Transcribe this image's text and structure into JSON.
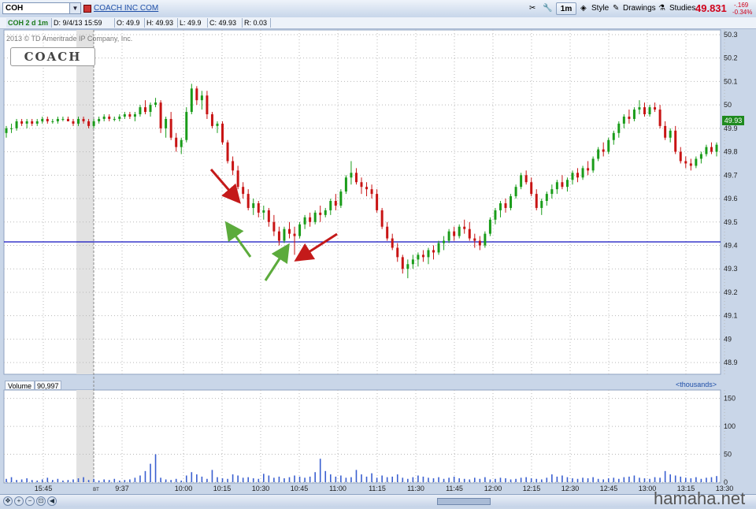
{
  "toolbar": {
    "symbol": "COH",
    "company_name": "COACH INC COM",
    "timeframe_label": "1m",
    "style_label": "Style",
    "drawings_label": "Drawings",
    "studies_label": "Studies",
    "last_price": "49.831",
    "change": "-.169",
    "change_pct": "-0.34%"
  },
  "info_bar": {
    "chart_label": "COH 2 d 1m",
    "date": "D: 9/4/13 15:59",
    "open": "O: 49.9",
    "high": "H: 49.93",
    "low": "L: 49.9",
    "close": "C: 49.93",
    "range": "R: 0.03"
  },
  "overlay": {
    "copyright": "2013 © TD Ameritrade IP Company, Inc.",
    "logo_text": "COACH",
    "price_badge": "49.93"
  },
  "volume": {
    "label": "Volume",
    "value": "90,997",
    "units": "<thousands>"
  },
  "watermark": "hamaha.net",
  "colors": {
    "up": "#1a9c1a",
    "down": "#c81414",
    "hline": "#1010c0",
    "volume": "#3a5fd0"
  },
  "chart_data": {
    "type": "candlestick",
    "price_axis": {
      "ylim": [
        48.85,
        50.32
      ],
      "ticks": [
        50.3,
        50.2,
        50.1,
        50,
        49.9,
        49.8,
        49.7,
        49.6,
        49.5,
        49.4,
        49.3,
        49.2,
        49.1,
        49,
        48.9
      ],
      "tick_labels": [
        "50.3",
        "50.2",
        "50.1",
        "50",
        "49.9",
        "49.8",
        "49.7",
        "49.6",
        "49.5",
        "49.4",
        "49.3",
        "49.2",
        "49.1",
        "49",
        "48.9"
      ]
    },
    "volume_axis": {
      "ylim": [
        0,
        165
      ],
      "ticks": [
        150,
        100,
        50,
        0
      ],
      "tick_labels": [
        "150",
        "100",
        "50",
        "0"
      ]
    },
    "time_axis": {
      "labels": [
        "15:45",
        "BT",
        "9:37",
        "10:00",
        "10:15",
        "10:30",
        "10:45",
        "11:00",
        "11:15",
        "11:30",
        "11:45",
        "12:00",
        "12:15",
        "12:30",
        "12:45",
        "13:00",
        "13:15",
        "13:30"
      ]
    },
    "horizontal_line": 49.415,
    "bars": [
      [
        49.88,
        49.91,
        49.86,
        49.9
      ],
      [
        49.9,
        49.92,
        49.88,
        49.9
      ],
      [
        49.9,
        49.94,
        49.89,
        49.93
      ],
      [
        49.93,
        49.94,
        49.91,
        49.92
      ],
      [
        49.92,
        49.94,
        49.9,
        49.93
      ],
      [
        49.93,
        49.94,
        49.91,
        49.92
      ],
      [
        49.92,
        49.94,
        49.91,
        49.93
      ],
      [
        49.93,
        49.95,
        49.92,
        49.94
      ],
      [
        49.94,
        49.95,
        49.92,
        49.93
      ],
      [
        49.93,
        49.94,
        49.92,
        49.93
      ],
      [
        49.93,
        49.95,
        49.92,
        49.94
      ],
      [
        49.94,
        49.95,
        49.93,
        49.94
      ],
      [
        49.94,
        49.95,
        49.93,
        49.93
      ],
      [
        49.93,
        49.94,
        49.91,
        49.92
      ],
      [
        49.92,
        49.95,
        49.91,
        49.94
      ],
      [
        49.94,
        49.95,
        49.92,
        49.93
      ],
      [
        49.93,
        49.94,
        49.9,
        49.91
      ],
      [
        49.91,
        49.94,
        49.9,
        49.93
      ],
      [
        49.93,
        49.95,
        49.92,
        49.94
      ],
      [
        49.94,
        49.96,
        49.93,
        49.95
      ],
      [
        49.95,
        49.96,
        49.93,
        49.94
      ],
      [
        49.94,
        49.95,
        49.93,
        49.94
      ],
      [
        49.94,
        49.96,
        49.93,
        49.95
      ],
      [
        49.95,
        49.97,
        49.94,
        49.96
      ],
      [
        49.96,
        49.97,
        49.94,
        49.95
      ],
      [
        49.95,
        49.97,
        49.93,
        49.96
      ],
      [
        49.96,
        50.0,
        49.95,
        49.99
      ],
      [
        49.99,
        50.02,
        49.96,
        49.97
      ],
      [
        49.97,
        50.01,
        49.95,
        50.0
      ],
      [
        50.0,
        50.03,
        49.99,
        50.01
      ],
      [
        50.01,
        50.02,
        49.88,
        49.9
      ],
      [
        49.9,
        49.95,
        49.86,
        49.94
      ],
      [
        49.94,
        49.97,
        49.85,
        49.86
      ],
      [
        49.86,
        49.88,
        49.8,
        49.82
      ],
      [
        49.82,
        49.86,
        49.79,
        49.85
      ],
      [
        49.85,
        49.99,
        49.84,
        49.97
      ],
      [
        49.97,
        50.09,
        49.96,
        50.07
      ],
      [
        50.07,
        50.08,
        50.0,
        50.02
      ],
      [
        50.02,
        50.06,
        49.98,
        50.04
      ],
      [
        50.04,
        50.06,
        49.94,
        49.96
      ],
      [
        49.96,
        49.97,
        49.9,
        49.91
      ],
      [
        49.91,
        49.93,
        49.88,
        49.92
      ],
      [
        49.92,
        49.93,
        49.83,
        49.84
      ],
      [
        49.84,
        49.85,
        49.75,
        49.76
      ],
      [
        49.76,
        49.78,
        49.7,
        49.72
      ],
      [
        49.72,
        49.74,
        49.64,
        49.65
      ],
      [
        49.65,
        49.67,
        49.6,
        49.62
      ],
      [
        49.62,
        49.64,
        49.55,
        49.56
      ],
      [
        49.56,
        49.6,
        49.53,
        49.58
      ],
      [
        49.58,
        49.59,
        49.52,
        49.54
      ],
      [
        49.54,
        49.57,
        49.51,
        49.55
      ],
      [
        49.55,
        49.56,
        49.48,
        49.5
      ],
      [
        49.5,
        49.53,
        49.44,
        49.46
      ],
      [
        49.46,
        49.48,
        49.4,
        49.42
      ],
      [
        49.42,
        49.48,
        49.41,
        49.47
      ],
      [
        49.47,
        49.5,
        49.43,
        49.45
      ],
      [
        49.45,
        49.48,
        49.36,
        49.44
      ],
      [
        49.44,
        49.5,
        49.43,
        49.49
      ],
      [
        49.49,
        49.53,
        49.47,
        49.52
      ],
      [
        49.52,
        49.54,
        49.48,
        49.5
      ],
      [
        49.5,
        49.55,
        49.49,
        49.54
      ],
      [
        49.54,
        49.57,
        49.5,
        49.53
      ],
      [
        49.53,
        49.56,
        49.52,
        49.55
      ],
      [
        49.55,
        49.6,
        49.53,
        49.59
      ],
      [
        49.59,
        49.62,
        49.55,
        49.57
      ],
      [
        49.57,
        49.64,
        49.56,
        49.63
      ],
      [
        49.63,
        49.7,
        49.62,
        49.69
      ],
      [
        49.69,
        49.76,
        49.66,
        49.71
      ],
      [
        49.71,
        49.73,
        49.66,
        49.67
      ],
      [
        49.67,
        49.69,
        49.62,
        49.65
      ],
      [
        49.65,
        49.67,
        49.61,
        49.64
      ],
      [
        49.64,
        49.66,
        49.6,
        49.62
      ],
      [
        49.62,
        49.64,
        49.54,
        49.55
      ],
      [
        49.55,
        49.56,
        49.47,
        49.48
      ],
      [
        49.48,
        49.5,
        49.42,
        49.43
      ],
      [
        49.43,
        49.45,
        49.38,
        49.39
      ],
      [
        49.39,
        49.41,
        49.33,
        49.35
      ],
      [
        49.35,
        49.36,
        49.28,
        49.3
      ],
      [
        49.3,
        49.34,
        49.26,
        49.32
      ],
      [
        49.32,
        49.36,
        49.3,
        49.34
      ],
      [
        49.34,
        49.37,
        49.31,
        49.36
      ],
      [
        49.36,
        49.38,
        49.33,
        49.35
      ],
      [
        49.35,
        49.39,
        49.32,
        49.38
      ],
      [
        49.38,
        49.4,
        49.34,
        49.37
      ],
      [
        49.37,
        49.42,
        49.36,
        49.41
      ],
      [
        49.41,
        49.44,
        49.38,
        49.42
      ],
      [
        49.42,
        49.47,
        49.41,
        49.46
      ],
      [
        49.46,
        49.48,
        49.42,
        49.44
      ],
      [
        49.44,
        49.49,
        49.43,
        49.48
      ],
      [
        49.48,
        49.51,
        49.45,
        49.47
      ],
      [
        49.47,
        49.5,
        49.42,
        49.43
      ],
      [
        49.43,
        49.45,
        49.39,
        49.42
      ],
      [
        49.42,
        49.44,
        49.38,
        49.4
      ],
      [
        49.4,
        49.46,
        49.39,
        49.45
      ],
      [
        49.45,
        49.52,
        49.44,
        49.51
      ],
      [
        49.51,
        49.56,
        49.49,
        49.55
      ],
      [
        49.55,
        49.59,
        49.52,
        49.58
      ],
      [
        49.58,
        49.6,
        49.54,
        49.56
      ],
      [
        49.56,
        49.62,
        49.55,
        49.61
      ],
      [
        49.61,
        49.66,
        49.6,
        49.65
      ],
      [
        49.65,
        49.71,
        49.64,
        49.7
      ],
      [
        49.7,
        49.72,
        49.66,
        49.67
      ],
      [
        49.67,
        49.69,
        49.61,
        49.62
      ],
      [
        49.62,
        49.64,
        49.55,
        49.56
      ],
      [
        49.56,
        49.6,
        49.53,
        49.59
      ],
      [
        49.59,
        49.63,
        49.57,
        49.62
      ],
      [
        49.62,
        49.66,
        49.6,
        49.64
      ],
      [
        49.64,
        49.68,
        49.62,
        49.67
      ],
      [
        49.67,
        49.7,
        49.64,
        49.65
      ],
      [
        49.65,
        49.69,
        49.63,
        49.68
      ],
      [
        49.68,
        49.72,
        49.66,
        49.71
      ],
      [
        49.71,
        49.73,
        49.67,
        49.69
      ],
      [
        49.69,
        49.74,
        49.68,
        49.73
      ],
      [
        49.73,
        49.76,
        49.7,
        49.72
      ],
      [
        49.72,
        49.78,
        49.71,
        49.77
      ],
      [
        49.77,
        49.82,
        49.76,
        49.81
      ],
      [
        49.81,
        49.84,
        49.78,
        49.8
      ],
      [
        49.8,
        49.86,
        49.79,
        49.85
      ],
      [
        49.85,
        49.89,
        49.83,
        49.88
      ],
      [
        49.88,
        49.93,
        49.86,
        49.92
      ],
      [
        49.92,
        49.96,
        49.9,
        49.95
      ],
      [
        49.95,
        49.98,
        49.92,
        49.94
      ],
      [
        49.94,
        49.99,
        49.93,
        49.98
      ],
      [
        49.98,
        50.02,
        49.96,
        49.99
      ],
      [
        49.99,
        50.01,
        49.95,
        49.96
      ],
      [
        49.96,
        50.0,
        49.95,
        49.99
      ],
      [
        49.99,
        50.01,
        49.97,
        49.98
      ],
      [
        49.98,
        50.0,
        49.9,
        49.91
      ],
      [
        49.91,
        49.93,
        49.85,
        49.86
      ],
      [
        49.86,
        49.9,
        49.84,
        49.89
      ],
      [
        49.89,
        49.91,
        49.79,
        49.8
      ],
      [
        49.8,
        49.82,
        49.75,
        49.76
      ],
      [
        49.76,
        49.78,
        49.73,
        49.75
      ],
      [
        49.75,
        49.77,
        49.72,
        49.74
      ],
      [
        49.74,
        49.78,
        49.73,
        49.77
      ],
      [
        49.77,
        49.8,
        49.75,
        49.79
      ],
      [
        49.79,
        49.83,
        49.78,
        49.82
      ],
      [
        49.82,
        49.84,
        49.79,
        49.8
      ],
      [
        49.8,
        49.84,
        49.78,
        49.83
      ]
    ],
    "volumes": [
      6,
      9,
      4,
      5,
      7,
      4,
      3,
      5,
      8,
      4,
      6,
      3,
      4,
      5,
      7,
      9,
      4,
      6,
      3,
      5,
      4,
      6,
      3,
      4,
      5,
      8,
      12,
      20,
      33,
      50,
      8,
      5,
      4,
      6,
      3,
      12,
      18,
      14,
      10,
      6,
      22,
      9,
      7,
      6,
      14,
      12,
      8,
      9,
      7,
      6,
      15,
      12,
      8,
      10,
      7,
      9,
      12,
      10,
      8,
      10,
      18,
      42,
      20,
      14,
      10,
      12,
      8,
      9,
      22,
      14,
      10,
      16,
      8,
      12,
      9,
      10,
      14,
      8,
      6,
      9,
      12,
      10,
      8,
      7,
      9,
      6,
      8,
      10,
      7,
      6,
      5,
      8,
      6,
      9,
      5,
      6,
      8,
      7,
      5,
      6,
      8,
      9,
      7,
      6,
      5,
      8,
      14,
      10,
      12,
      9,
      7,
      6,
      8,
      7,
      9,
      6,
      5,
      7,
      8,
      6,
      9,
      10,
      12,
      8,
      7,
      6,
      9,
      8,
      20,
      14,
      12,
      10,
      8,
      7,
      9,
      6,
      8,
      9,
      11,
      8
    ]
  }
}
